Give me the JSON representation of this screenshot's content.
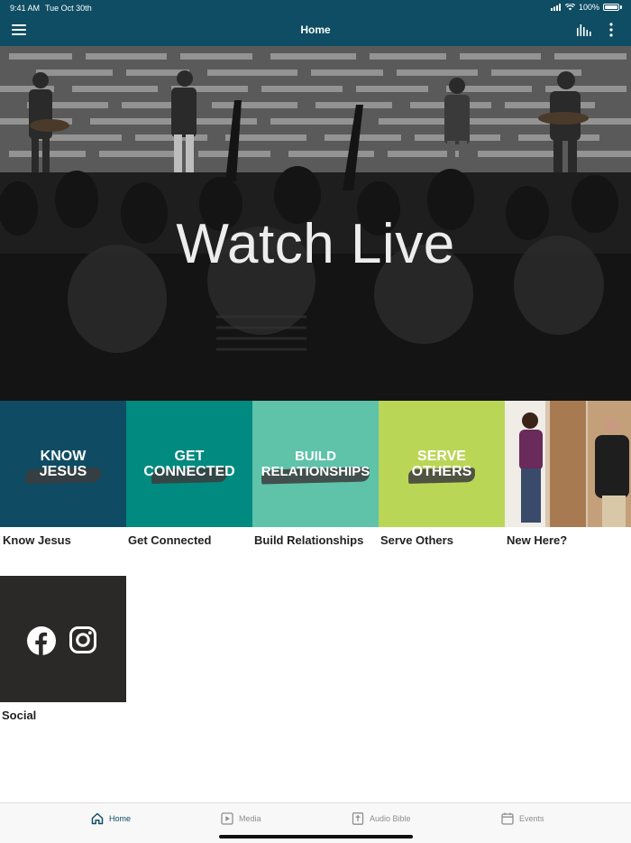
{
  "status_bar": {
    "time": "9:41 AM",
    "date": "Tue Oct 30th",
    "battery": "100%"
  },
  "nav": {
    "title": "Home",
    "left_icon": "hamburger-menu-icon",
    "right_icons": [
      "audio-levels-icon",
      "more-vertical-icon"
    ]
  },
  "hero": {
    "title": "Watch Live"
  },
  "tiles": [
    {
      "line1": "KNOW",
      "line2": "JESUS",
      "label": "Know Jesus",
      "color": "#0f4c64"
    },
    {
      "line1": "GET",
      "line2": "CONNECTED",
      "label": "Get Connected",
      "color": "#008a80"
    },
    {
      "line1": "BUILD",
      "line2": "RELATIONSHIPS",
      "label": "Build Relationships",
      "color": "#5ec3a8"
    },
    {
      "line1": "SERVE",
      "line2": "OTHERS",
      "label": "Serve Others",
      "color": "#bad657"
    },
    {
      "line1": "",
      "line2": "",
      "label": "New Here?",
      "color": "#8a6a4a"
    }
  ],
  "social": {
    "label": "Social",
    "icons": [
      "facebook-icon",
      "instagram-icon"
    ],
    "color": "#2b2828"
  },
  "tabbar": {
    "tabs": [
      {
        "label": "Home",
        "icon": "home-icon",
        "active": true
      },
      {
        "label": "Media",
        "icon": "play-icon",
        "active": false
      },
      {
        "label": "Audio Bible",
        "icon": "bible-icon",
        "active": false
      },
      {
        "label": "Events",
        "icon": "calendar-icon",
        "active": false
      }
    ]
  },
  "colors": {
    "brand": "#0e4d63",
    "tab_inactive": "#8e8e8e"
  }
}
